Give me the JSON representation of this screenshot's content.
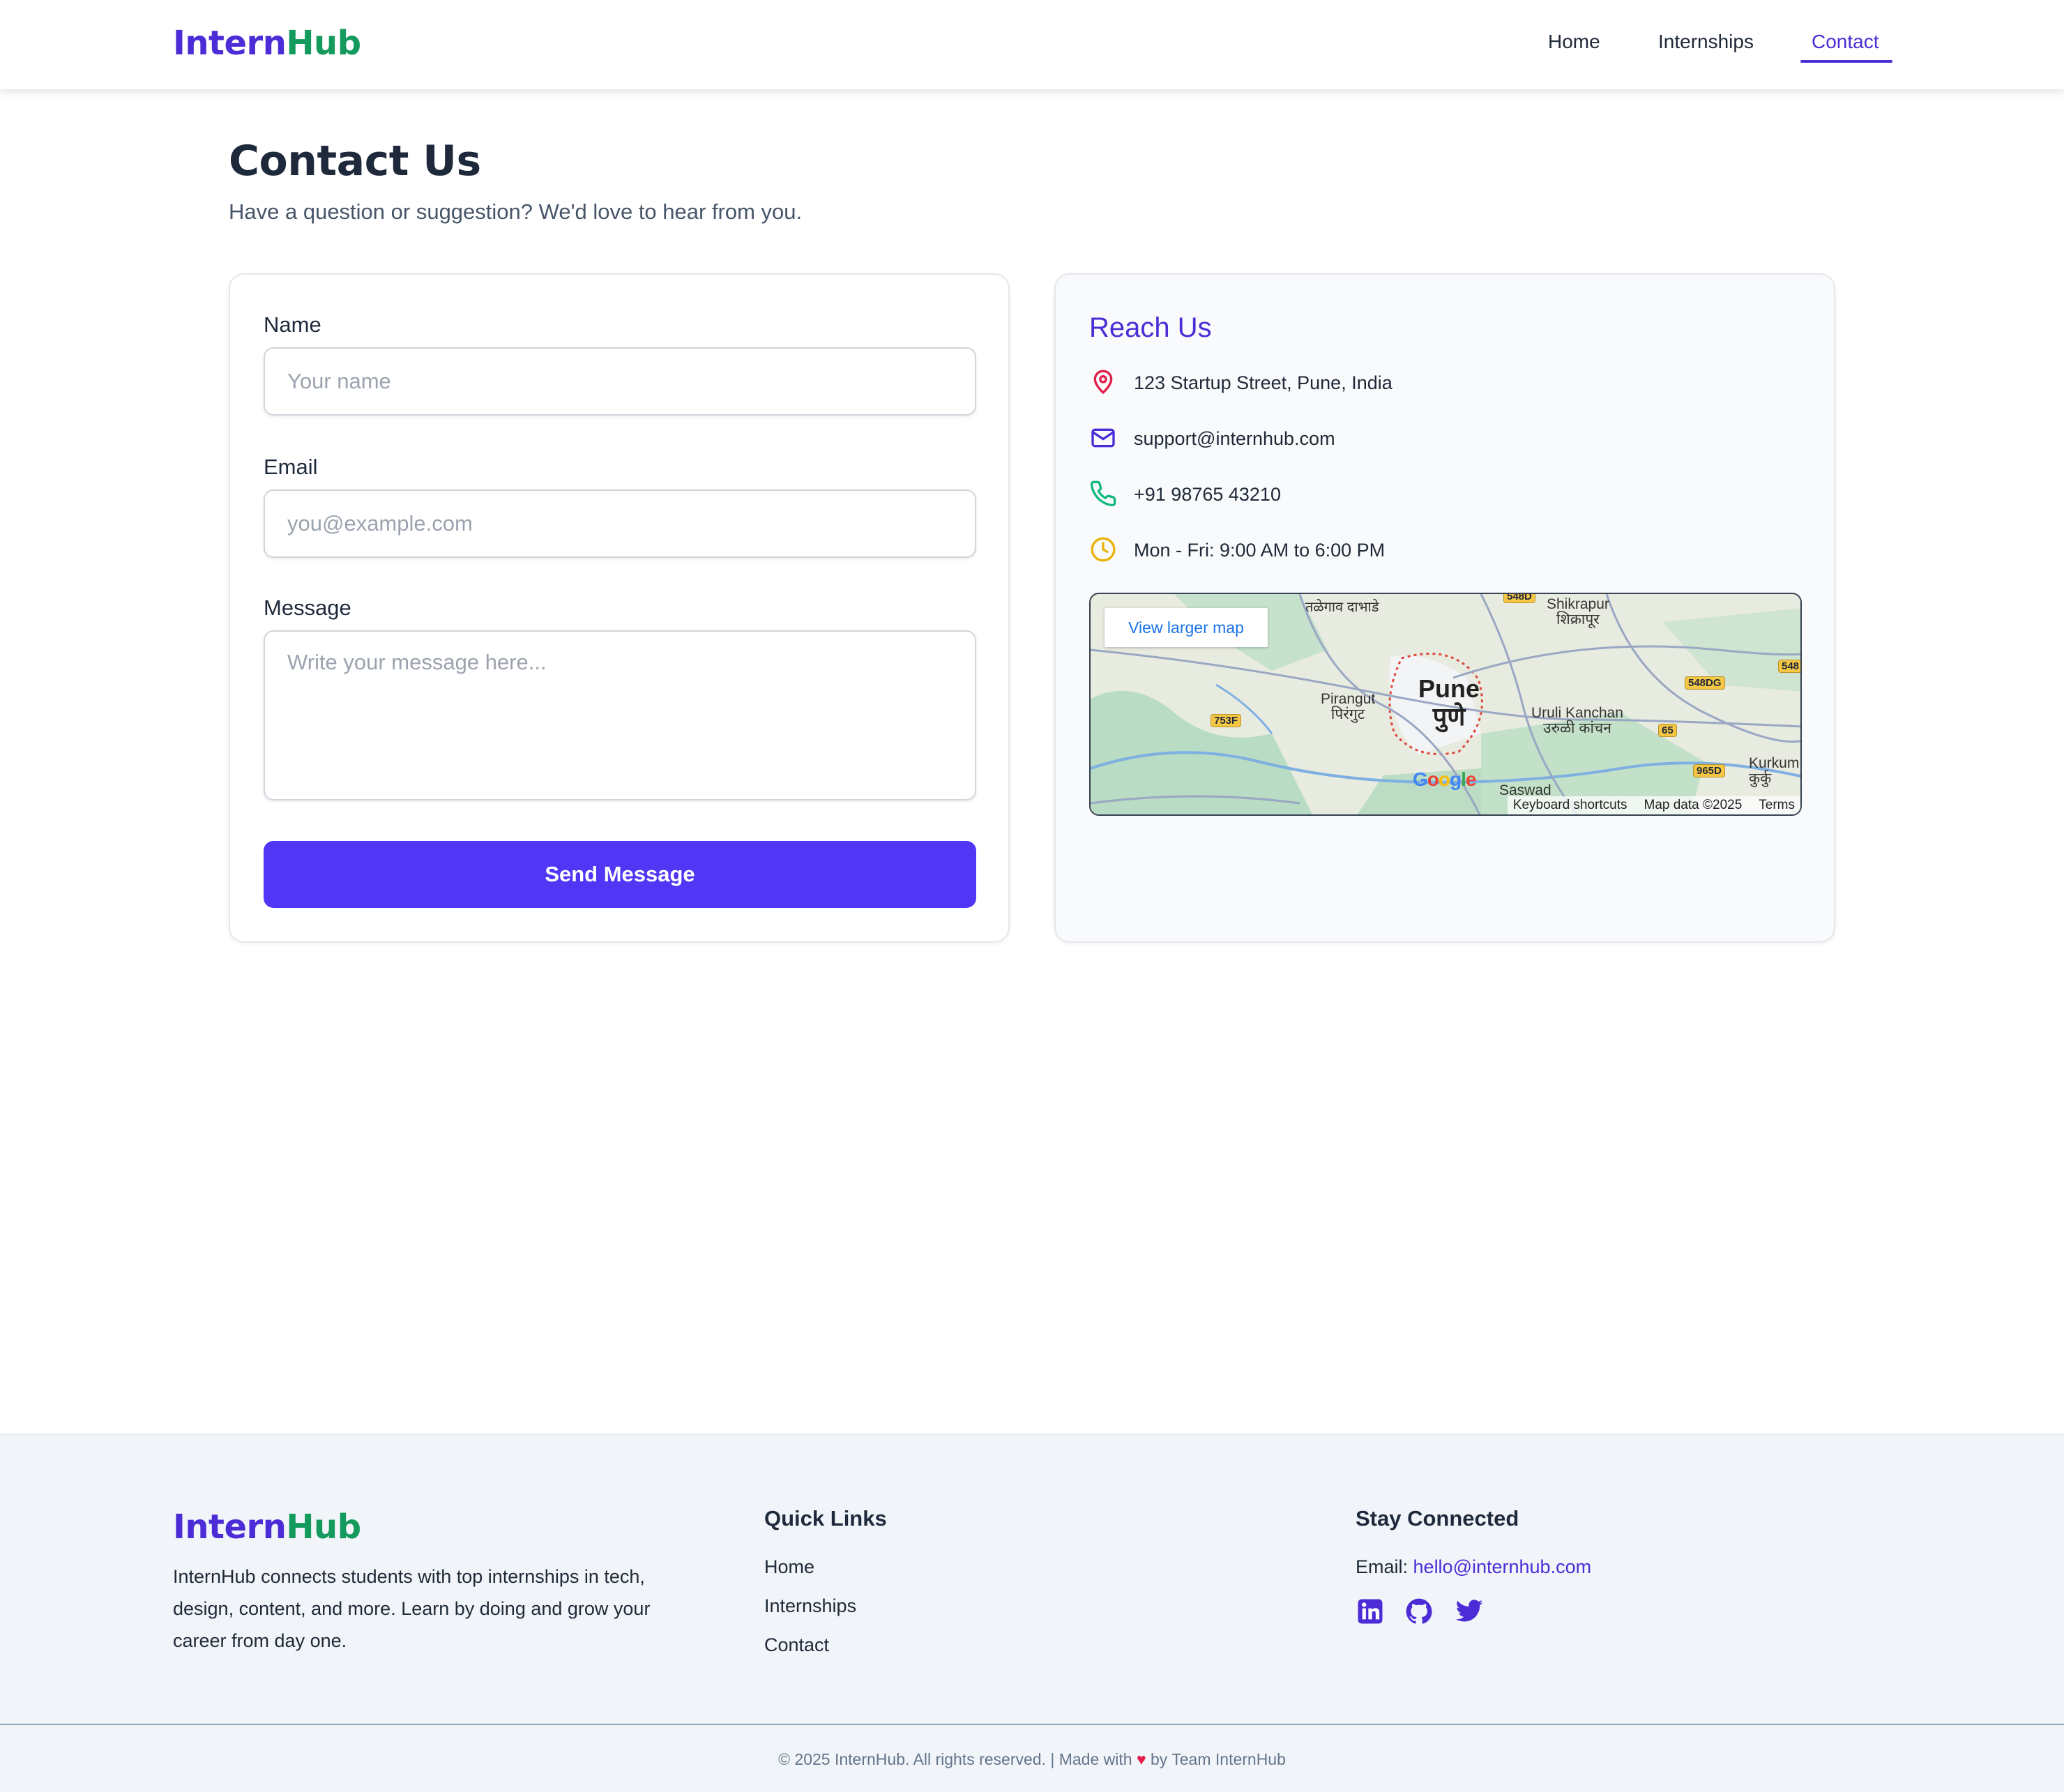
{
  "header": {
    "logo_part1": "Intern",
    "logo_part2": "Hub",
    "nav": [
      "Home",
      "Internships",
      "Contact"
    ],
    "active_nav": "Contact"
  },
  "page": {
    "title": "Contact Us",
    "subtitle": "Have a question or suggestion? We'd love to hear from you."
  },
  "form": {
    "name_label": "Name",
    "name_placeholder": "Your name",
    "email_label": "Email",
    "email_placeholder": "you@example.com",
    "message_label": "Message",
    "message_placeholder": "Write your message here...",
    "submit_label": "Send Message"
  },
  "reach": {
    "title": "Reach Us",
    "address": "123 Startup Street, Pune, India",
    "email": "support@internhub.com",
    "phone": "+91 98765 43210",
    "hours": "Mon - Fri: 9:00 AM to 6:00 PM",
    "icons": [
      "map-pin-icon",
      "mail-icon",
      "phone-icon",
      "clock-icon"
    ],
    "icon_colors": {
      "pin": "#e11d48",
      "mail": "#4c2cd6",
      "phone": "#10b981",
      "clock": "#eab308"
    }
  },
  "map": {
    "button_label": "View larger map",
    "city_en": "Pune",
    "city_mr": "पुणे",
    "places": [
      {
        "en": "Shikrapur",
        "mr": "शिक्रापूर"
      },
      {
        "en": "Pirangut",
        "mr": "पिरंगुट"
      },
      {
        "en": "Uruli Kanchan",
        "mr": "उरुळी कांचन"
      },
      {
        "en": "Saswad",
        "mr": ""
      },
      {
        "en": "Kurkum",
        "mr": "कुर्कु"
      },
      {
        "en": "",
        "mr": "तळेगाव दाभाडे"
      }
    ],
    "road_badges": [
      "548D",
      "548DG",
      "753F",
      "65",
      "965D",
      "548"
    ],
    "google_logo": "Google",
    "footer_links": [
      "Keyboard shortcuts",
      "Map data ©2025",
      "Terms"
    ]
  },
  "footer": {
    "logo_part1": "Intern",
    "logo_part2": "Hub",
    "description": "InternHub connects students with top internships in tech, design, content, and more. Learn by doing and grow your career from day one.",
    "quick_links_title": "Quick Links",
    "quick_links": [
      "Home",
      "Internships",
      "Contact"
    ],
    "connect_title": "Stay Connected",
    "email_label": "Email:",
    "email_value": "hello@internhub.com",
    "social_icons": [
      "linkedin-icon",
      "github-icon",
      "twitter-icon"
    ],
    "social_color": "#4c2cd6",
    "copyright_prefix": "© 2025 InternHub. All rights reserved. | Made with",
    "copyright_heart": "♥",
    "copyright_suffix": "by Team InternHub"
  },
  "colors": {
    "brand_indigo": "#4c2cd6",
    "brand_green": "#149a5c",
    "button": "#5136f5"
  }
}
